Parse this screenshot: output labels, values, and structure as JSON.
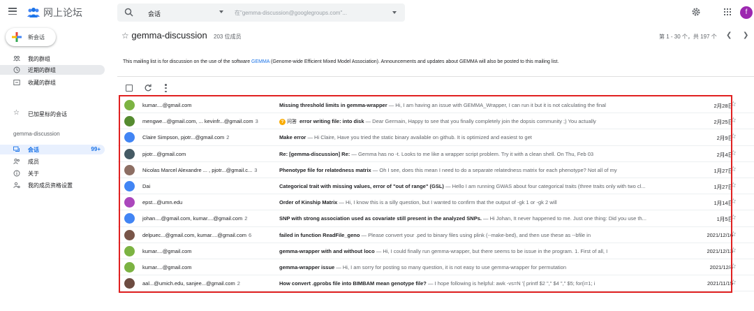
{
  "header": {
    "app_title": "网上论坛",
    "search_value": "会话",
    "scope_placeholder": "在\"gemma-discussion@googlegroups.com\"...",
    "user_initial": "f"
  },
  "sidebar": {
    "compose_label": "新会话",
    "top_items": [
      {
        "label": "我的群组",
        "icon": "groups-icon"
      },
      {
        "label": "近期的群组",
        "icon": "clock-icon"
      },
      {
        "label": "收藏的群组",
        "icon": "folder-icon"
      }
    ],
    "starred_label": "已加星标的会话",
    "group_name": "gemma-discussion",
    "group_items": [
      {
        "label": "会话",
        "count": "99+",
        "icon": "conversations-icon"
      },
      {
        "label": "成员",
        "icon": "members-icon"
      },
      {
        "label": "关于",
        "icon": "info-icon"
      },
      {
        "label": "我的成员资格设置",
        "icon": "member-settings-icon"
      }
    ]
  },
  "main": {
    "group_title": "gemma-discussion",
    "member_count": "203 位成员",
    "pagination": "第 1 - 30 个，共 197 个",
    "description_pre": "This mailing list is for discussion on the use of the software ",
    "description_link": "GEMMA",
    "description_post": " (Genome-wide Efficient Mixed Model Association). Announcements and updates about GEMMA will also be posted to this mailing list.",
    "badge_label": "问答"
  },
  "threads": [
    {
      "participants": "kumar....@gmail.com",
      "n": "",
      "subject": "Missing threshold limits in gemma-wrapper",
      "snippet": " — Hi, I am having an issue with GEMMA_Wrapper, I can run it but it is not calculating the final",
      "date": "2月28日",
      "avatar_color": "#7cb342",
      "badge": false
    },
    {
      "participants": "mengwe...@gmail.com, ... kevinfr...@gmail.com",
      "n": "3",
      "subject": "error writing file: into disk",
      "snippet": " — Dear Germain, Happy to see that you finally completely join the dopsis community ;) You actually",
      "date": "2月25日",
      "avatar_color": "#558b2f",
      "badge": true
    },
    {
      "participants": "Claire Simpson, pjotr...@gmail.com",
      "n": "2",
      "subject": "Make error",
      "snippet": " — Hi Claire, Have you tried the static binary available on github. It is optimized and easiest to get",
      "date": "2月9日",
      "avatar_color": "#4285f4",
      "badge": false
    },
    {
      "participants": "pjotr...@gmail.com",
      "n": "",
      "subject": "Re: [gemma-discussion] Re:",
      "snippet": " — Gemma has no -t. Looks to me like a wrapper script problem. Try it with a clean shell. On Thu, Feb 03",
      "date": "2月4日",
      "avatar_color": "#455a64",
      "badge": false
    },
    {
      "participants": "Nicolas Marcel Alexandre ... , pjotr...@gmail.c...",
      "n": "3",
      "subject": "Phenotype file for relatedness matrix",
      "snippet": " — Oh I see, does this mean I need to do a separate relatedness matrix for each phenotype? Not all of my",
      "date": "1月27日",
      "avatar_color": "#8d6e63",
      "badge": false
    },
    {
      "participants": "Dai",
      "n": "",
      "subject": "Categorical trait with missing values, error of \"out of range\" (GSL)",
      "snippet": " — Hello I am running GWAS about four categorical traits (three traits only with two cl...",
      "date": "1月27日",
      "avatar_color": "#4285f4",
      "badge": false
    },
    {
      "participants": "epst...@umn.edu",
      "n": "",
      "subject": "Order of Kinship Matrix",
      "snippet": " — Hi, I know this is a silly question, but I wanted to confirm that the output of -gk 1 or -gk 2 will",
      "date": "1月14日",
      "avatar_color": "#ab47bc",
      "badge": false
    },
    {
      "participants": "johan....@gmail.com, kumar....@gmail.com",
      "n": "2",
      "subject": "SNP with strong association used as covariate still present in the analyzed SNPs.",
      "snippet": " — Hi Johan, It never happened to me. Just one thing: Did you use th...",
      "date": "1月5日",
      "avatar_color": "#4285f4",
      "badge": false
    },
    {
      "participants": "delpuec...@gmail.com, kumar....@gmail.com",
      "n": "6",
      "subject": "failed in function ReadFile_geno",
      "snippet": " — Please convert your .ped to binary files using plink (--make-bed), and then use these as --bfile in",
      "date": "2021/12/16",
      "avatar_color": "#795548",
      "badge": false
    },
    {
      "participants": "kumar....@gmail.com",
      "n": "",
      "subject": "gemma-wrapper with and without loco",
      "snippet": " — Hi, I could finally run gemma-wrapper, but there seems to be issue in the program. 1. First of all, I",
      "date": "2021/12/13",
      "avatar_color": "#7cb342",
      "badge": false
    },
    {
      "participants": "kumar....@gmail.com",
      "n": "",
      "subject": "gemma-wrapper issue",
      "snippet": " — Hi, I am sorry for posting so many question, it is not easy to use gemma-wrapper for permutation",
      "date": "2021/12/4",
      "avatar_color": "#7cb342",
      "badge": false
    },
    {
      "participants": "aal...@umich.edu, sanjee...@gmail.com",
      "n": "2",
      "subject": "How convert .gprobs file into BIMBAM mean genotype file?",
      "snippet": " — I hope following is helpful: awk -vs=N '{ printf $2 \",\" $4 \",\" $5; for(i=1; i",
      "date": "2021/11/15",
      "avatar_color": "#6d4c41",
      "badge": false
    }
  ]
}
